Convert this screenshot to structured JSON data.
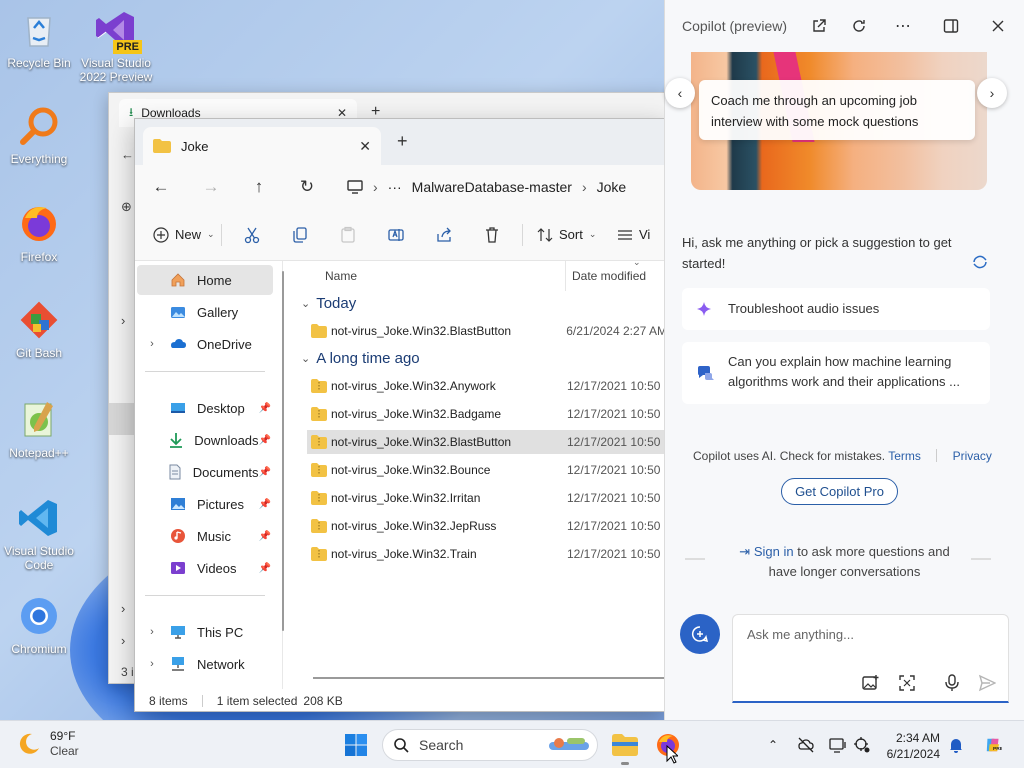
{
  "desktop": {
    "icons": [
      {
        "label": "Recycle Bin"
      },
      {
        "label": "Visual Studio 2022 Preview",
        "badge": "PRE"
      },
      {
        "label": "Everything"
      },
      {
        "label": "Firefox"
      },
      {
        "label": "Git Bash"
      },
      {
        "label": "Notepad++"
      },
      {
        "label": "Visual Studio Code"
      },
      {
        "label": "Chromium"
      }
    ]
  },
  "bg_window": {
    "tab_label": "Downloads",
    "status_fragment": "3 i"
  },
  "explorer": {
    "tab_label": "Joke",
    "breadcrumb": [
      "MalwareDatabase-master",
      "Joke"
    ],
    "more_crumbs": "···",
    "toolbar": {
      "new_label": "New",
      "sort_label": "Sort",
      "view_label": "Vi"
    },
    "nav": {
      "home": "Home",
      "gallery": "Gallery",
      "onedrive": "OneDrive",
      "desktop": "Desktop",
      "downloads": "Downloads",
      "documents": "Documents",
      "pictures": "Pictures",
      "music": "Music",
      "videos": "Videos",
      "thispc": "This PC",
      "network": "Network"
    },
    "columns": {
      "name": "Name",
      "date": "Date modified"
    },
    "groups": {
      "today": "Today",
      "long_ago": "A long time ago"
    },
    "files_today": [
      {
        "name": "not-virus_Joke.Win32.BlastButton",
        "date": "6/21/2024 2:27 AM"
      }
    ],
    "files_old": [
      {
        "name": "not-virus_Joke.Win32.Anywork",
        "date": "12/17/2021 10:50"
      },
      {
        "name": "not-virus_Joke.Win32.Badgame",
        "date": "12/17/2021 10:50"
      },
      {
        "name": "not-virus_Joke.Win32.BlastButton",
        "date": "12/17/2021 10:50",
        "selected": true
      },
      {
        "name": "not-virus_Joke.Win32.Bounce",
        "date": "12/17/2021 10:50"
      },
      {
        "name": "not-virus_Joke.Win32.Irritan",
        "date": "12/17/2021 10:50"
      },
      {
        "name": "not-virus_Joke.Win32.JepRuss",
        "date": "12/17/2021 10:50"
      },
      {
        "name": "not-virus_Joke.Win32.Train",
        "date": "12/17/2021 10:50"
      }
    ],
    "status": {
      "count": "8 items",
      "selected": "1 item selected",
      "size": "208 KB"
    }
  },
  "copilot": {
    "title": "Copilot (preview)",
    "carousel_text": "Coach me through an upcoming job interview with some mock questions",
    "greeting": "Hi, ask me anything or pick a suggestion to get started!",
    "suggestions": [
      "Troubleshoot audio issues",
      "Can you explain how machine learning algorithms work and their applications ..."
    ],
    "legal_text": "Copilot uses AI. Check for mistakes.",
    "terms": "Terms",
    "privacy": "Privacy",
    "pro_button": "Get Copilot Pro",
    "signin_link": "Sign in",
    "signin_rest_1": "to ask more questions and",
    "signin_rest_2": "have longer conversations",
    "input_placeholder": "Ask me anything..."
  },
  "taskbar": {
    "weather_temp": "69°F",
    "weather_desc": "Clear",
    "search_label": "Search",
    "time": "2:34 AM",
    "date": "6/21/2024"
  },
  "colors": {
    "accent": "#2b63c6",
    "folder": "#f2c244",
    "selection": "#e0e0e0"
  }
}
